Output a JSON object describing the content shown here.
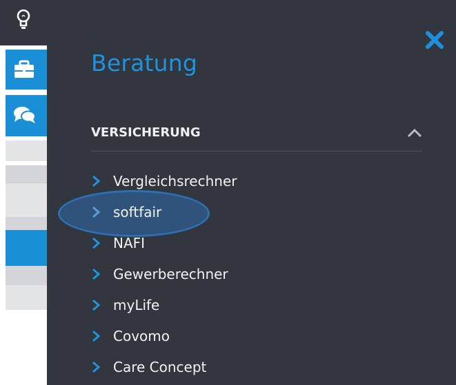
{
  "panel": {
    "title": "Beratung",
    "section": {
      "label": "VERSICHERUNG",
      "expanded": true
    },
    "items": [
      {
        "label": "Vergleichsrechner"
      },
      {
        "label": "softfair",
        "highlighted": true
      },
      {
        "label": "NAFI"
      },
      {
        "label": "Gewerberechner"
      },
      {
        "label": "myLife"
      },
      {
        "label": "Covomo"
      },
      {
        "label": "Care Concept"
      }
    ]
  },
  "icons": {
    "top": "lightbulb-icon",
    "tiles": [
      "briefcase-icon",
      "chat-icon"
    ],
    "close": "close-icon",
    "section_toggle": "chevron-up-icon",
    "item": "chevron-right-icon"
  },
  "colors": {
    "panel_bg": "#31363f",
    "accent": "#1b8fd6",
    "title": "#1e93de",
    "text": "#f2f3f5",
    "highlight": "#2d6fb3"
  }
}
